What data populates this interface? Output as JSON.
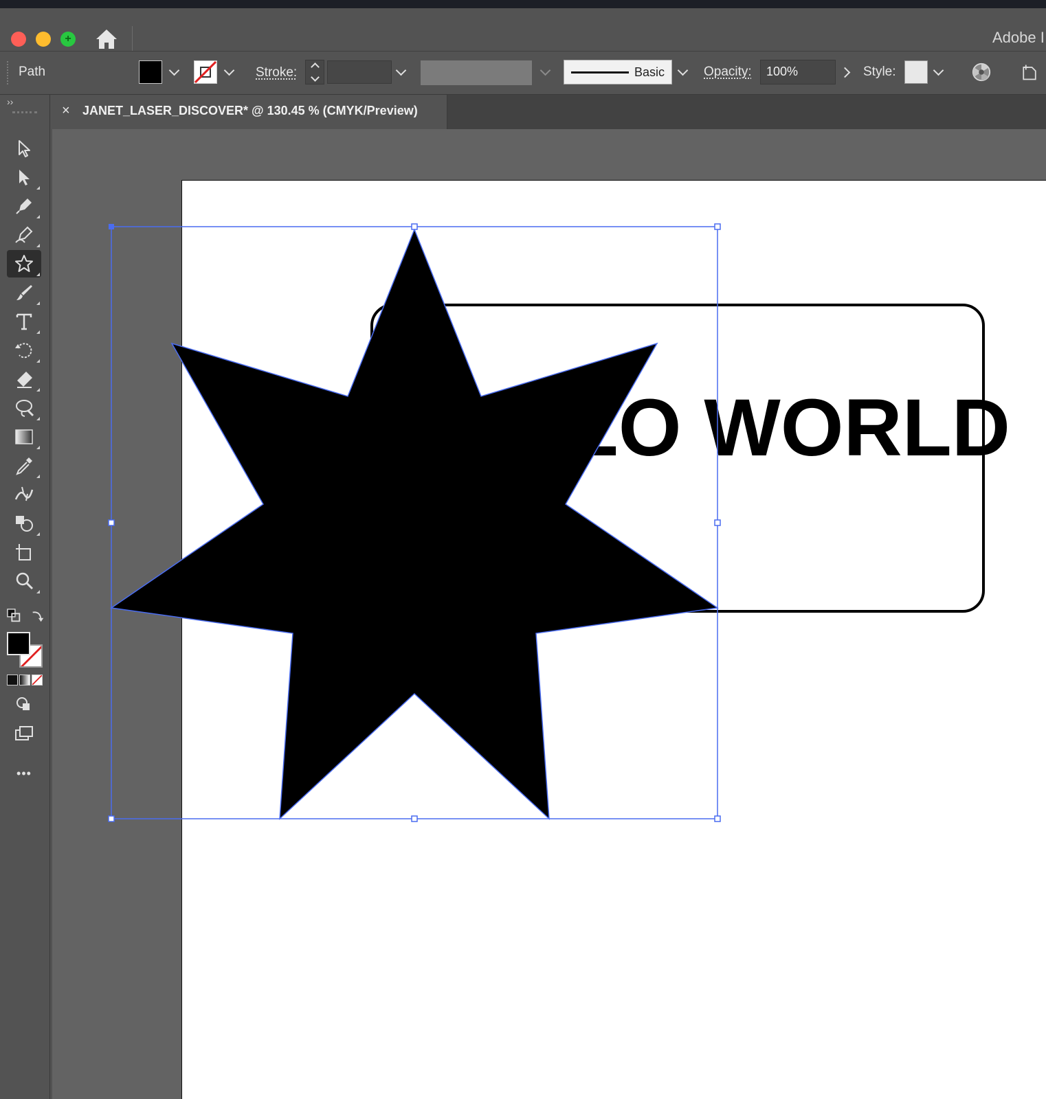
{
  "window": {
    "app_title": "Adobe I"
  },
  "control_bar": {
    "selection_type": "Path",
    "stroke_label": "Stroke:",
    "stroke_profile_label": "Basic",
    "opacity_label": "Opacity:",
    "opacity_value": "100%",
    "style_label": "Style:"
  },
  "document_tab": {
    "title": "JANET_LASER_DISCOVER* @ 130.45 % (CMYK/Preview)",
    "close_glyph": "×"
  },
  "toolbar": {
    "expand_glyph": "››",
    "more_glyph": "•••",
    "active_tool": "star-tool",
    "tools": [
      "selection-tool",
      "direct-selection-tool",
      "pen-tool",
      "curvature-tool",
      "star-tool",
      "paintbrush-tool",
      "type-tool",
      "rotate-tool",
      "eraser-tool",
      "puppet-warp-tool",
      "gradient-tool",
      "eyedropper-tool",
      "width-tool",
      "shape-builder-tool",
      "artboard-tool",
      "zoom-tool"
    ]
  },
  "artwork": {
    "text": "HELLO WORLD",
    "fill_color": "#000000",
    "selection_color": "#4a6cf0",
    "star_points": 7
  },
  "colors": {
    "panel": "#535353",
    "canvas": "#636363",
    "artboard": "#ffffff",
    "selection": "#4a6cf0"
  }
}
